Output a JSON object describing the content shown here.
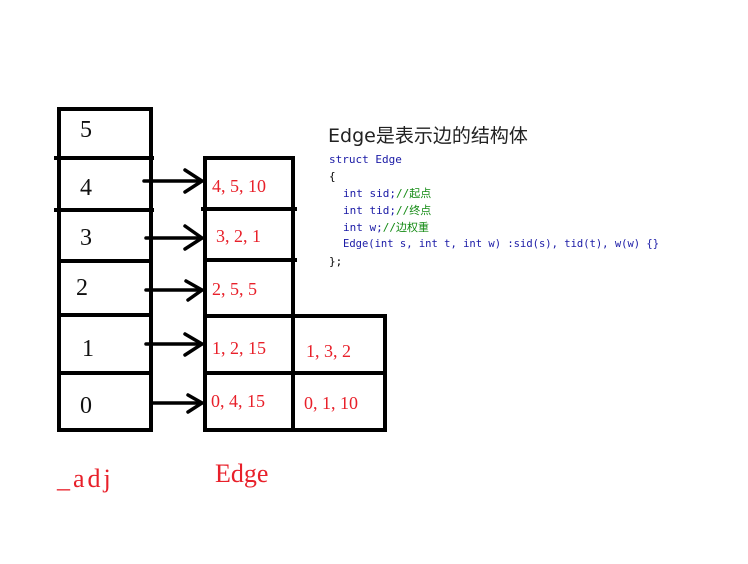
{
  "adj": {
    "label": "_adj",
    "indices": [
      "5",
      "4",
      "3",
      "2",
      "1",
      "0"
    ]
  },
  "edge_table": {
    "label": "Edge",
    "rows": [
      {
        "index": "4",
        "cells": [
          "4, 5, 10"
        ]
      },
      {
        "index": "3",
        "cells": [
          "3, 2, 1"
        ]
      },
      {
        "index": "2",
        "cells": [
          "2, 5, 5"
        ]
      },
      {
        "index": "1",
        "cells": [
          "1, 2, 15",
          "1, 3, 2"
        ]
      },
      {
        "index": "0",
        "cells": [
          "0, 4, 15",
          "0, 1, 10"
        ]
      }
    ]
  },
  "code": {
    "title": "Edge是表示边的结构体",
    "line1": "struct Edge",
    "line2": "{",
    "sid_decl": "int sid;",
    "sid_comment": "//起点",
    "tid_decl": "int tid;",
    "tid_comment": "//终点",
    "w_decl": "int w;",
    "w_comment": "//边权重",
    "ctor": "Edge(int s, int t, int w) :sid(s), tid(t), w(w) {}",
    "close": "};"
  },
  "colors": {
    "edge_text": "#e8202a",
    "keyword": "#1a1aa6",
    "comment": "#138a13"
  }
}
